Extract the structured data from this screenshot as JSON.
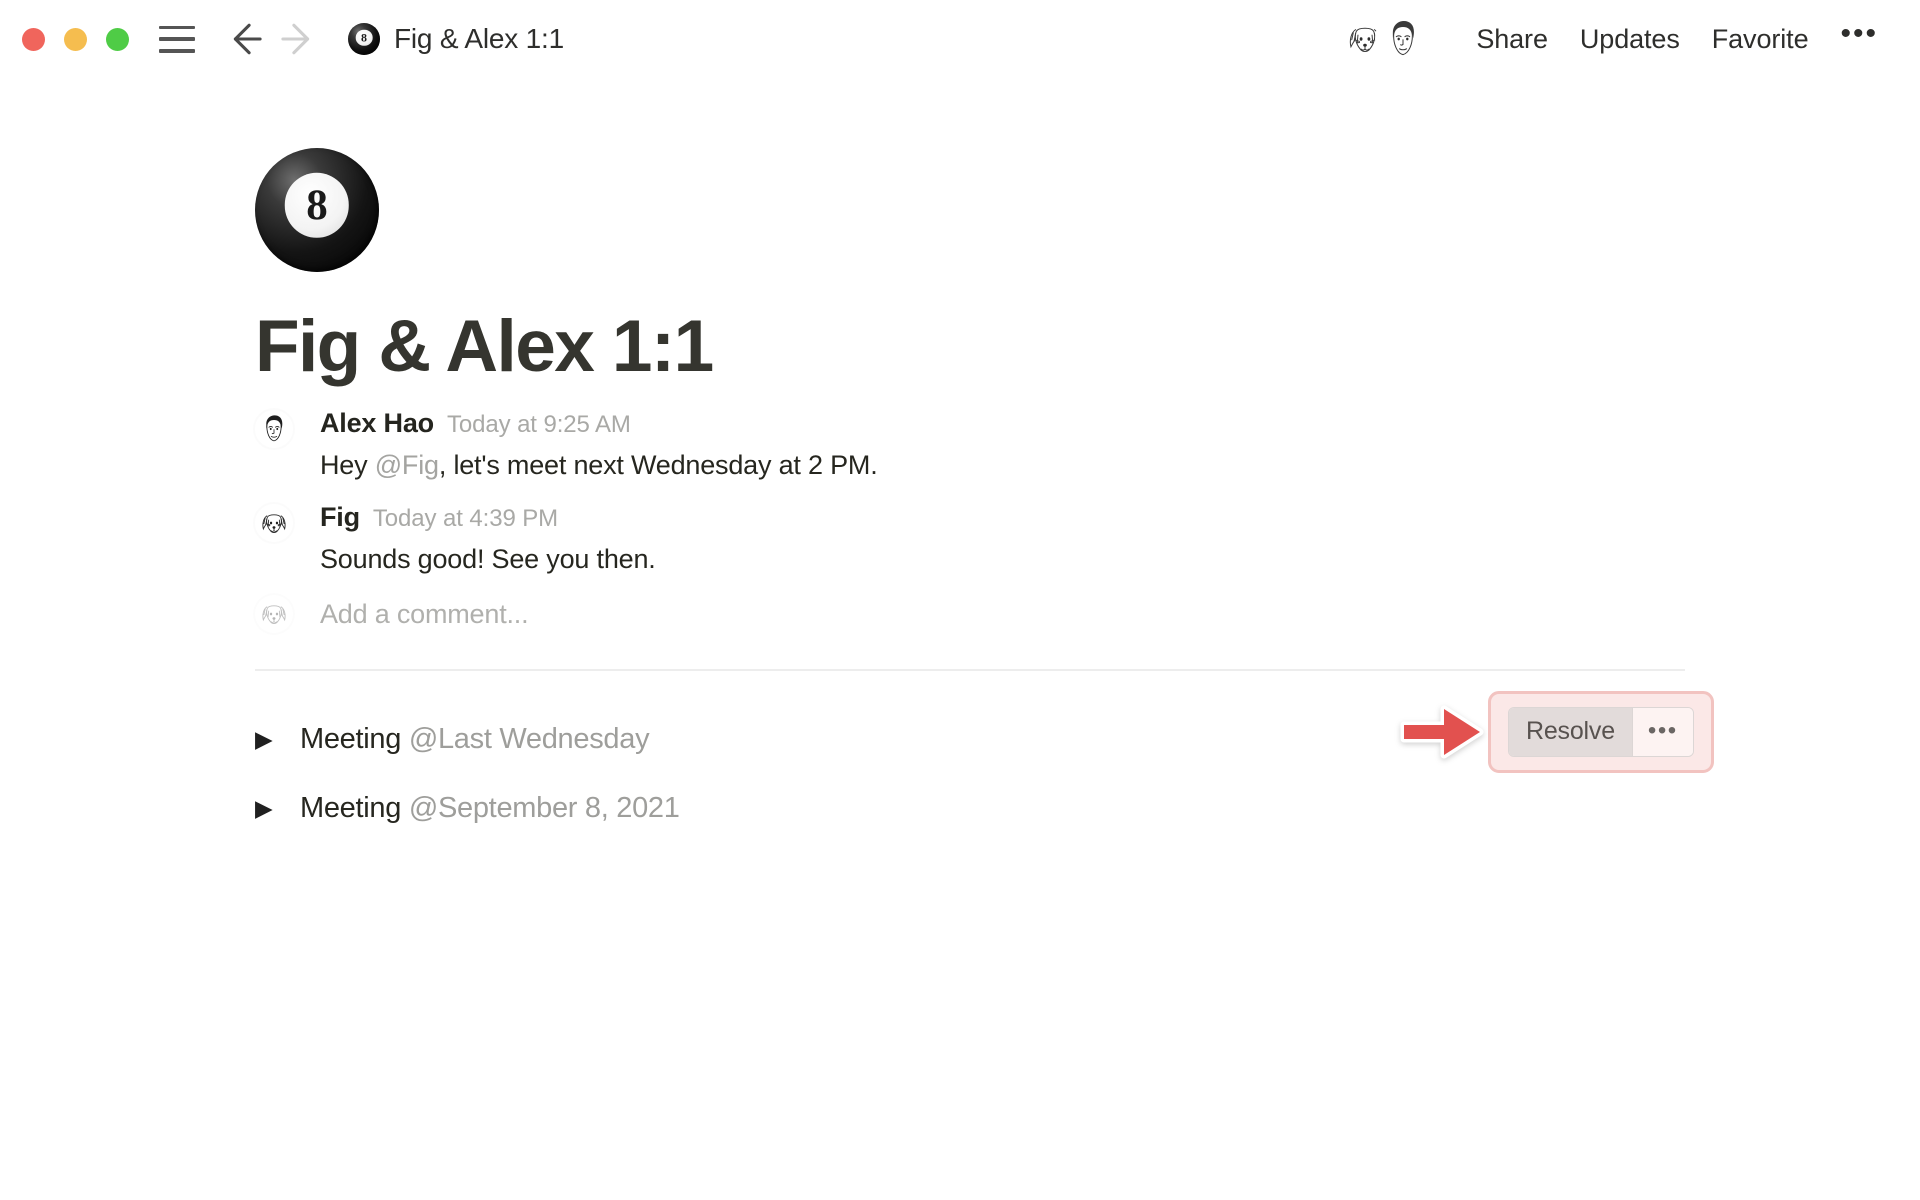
{
  "window": {
    "traffic_lights": [
      {
        "name": "close",
        "color": "#f0655c"
      },
      {
        "name": "minimize",
        "color": "#f5bd4f"
      },
      {
        "name": "maximize",
        "color": "#4fcc46"
      }
    ],
    "title": "Fig & Alex 1:1",
    "doc_icon": "eight-ball-emoji",
    "doc_icon_number": "8"
  },
  "header": {
    "menu_icon": "hamburger-menu-icon",
    "back_icon": "arrow-left-icon",
    "forward_icon": "arrow-right-icon",
    "avatars": [
      {
        "name": "fig-dog-avatar",
        "alt": "Fig"
      },
      {
        "name": "alex-hao-avatar",
        "alt": "Alex Hao"
      }
    ],
    "share_label": "Share",
    "updates_label": "Updates",
    "favorite_label": "Favorite",
    "more_label": "•••"
  },
  "page": {
    "icon_number": "8",
    "title": "Fig & Alex 1:1"
  },
  "thread": {
    "comments": [
      {
        "author": "Alex Hao",
        "time": "Today at 9:25 AM",
        "avatar": "alex-hao-avatar",
        "text_before": "Hey ",
        "mention": "@Fig",
        "text_after": ", let's meet next Wednesday at 2 PM."
      },
      {
        "author": "Fig",
        "time": "Today at 4:39 PM",
        "avatar": "fig-dog-avatar",
        "text_before": "Sounds good! See you then.",
        "mention": "",
        "text_after": ""
      }
    ],
    "add_comment_placeholder": "Add a comment...",
    "resolve_label": "Resolve",
    "resolve_more_label": "•••",
    "annotation": {
      "arrow": "red-arrow-pointing-right",
      "arrow_color": "#e2514f",
      "highlight_fill": "#fbe8e7",
      "highlight_border": "#f2c3c0"
    }
  },
  "toggles": [
    {
      "caret": "▶",
      "label": "Meeting",
      "reference": "@Last Wednesday"
    },
    {
      "caret": "▶",
      "label": "Meeting",
      "reference": "@September 8, 2021"
    }
  ]
}
